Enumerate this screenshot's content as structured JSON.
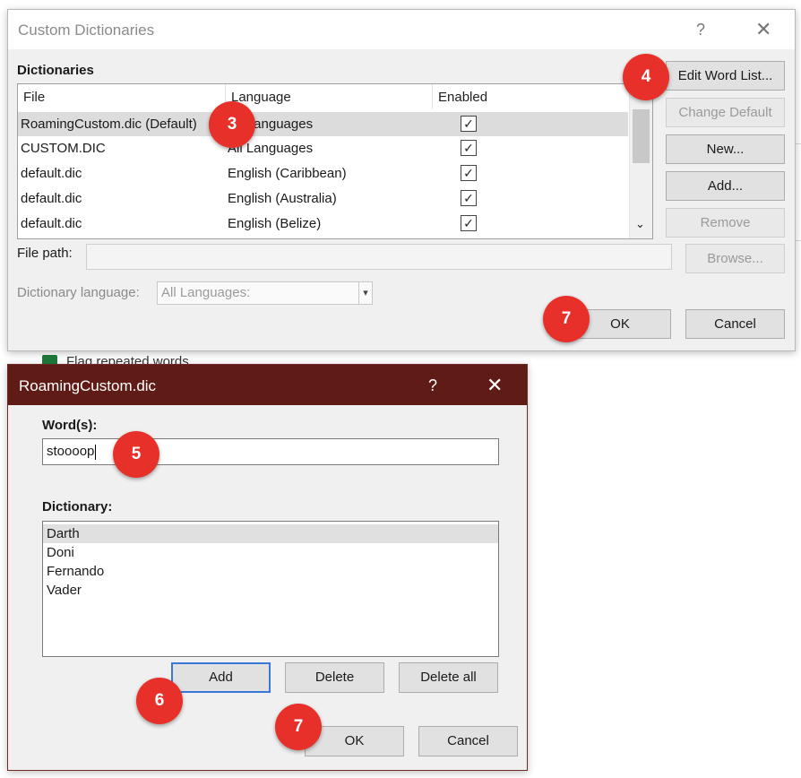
{
  "dialog1": {
    "title": "Custom Dictionaries",
    "help_icon": "?",
    "close_icon": "✕",
    "section_label": "Dictionaries",
    "columns": [
      "File",
      "Language",
      "Enabled"
    ],
    "rows": [
      {
        "file": "RoamingCustom.dic (Default)",
        "language": "All Languages",
        "enabled": true
      },
      {
        "file": "CUSTOM.DIC",
        "language": "All Languages",
        "enabled": true
      },
      {
        "file": "default.dic",
        "language": "English (Caribbean)",
        "enabled": true
      },
      {
        "file": "default.dic",
        "language": "English (Australia)",
        "enabled": true
      },
      {
        "file": "default.dic",
        "language": "English (Belize)",
        "enabled": true
      }
    ],
    "buttons": {
      "edit_word_list": "Edit Word List...",
      "change_default": "Change Default",
      "new": "New...",
      "add": "Add...",
      "remove": "Remove",
      "browse": "Browse...",
      "ok": "OK",
      "cancel": "Cancel"
    },
    "file_path_label": "File path:",
    "file_path_value": "",
    "dictionary_language_label": "Dictionary language:",
    "dictionary_language_value": "All Languages:"
  },
  "background": {
    "partial_option": "Flag repeated words"
  },
  "dialog2": {
    "title": "RoamingCustom.dic",
    "help_icon": "?",
    "close_icon": "✕",
    "words_label": "Word(s):",
    "words_value": "stoooop",
    "dictionary_label": "Dictionary:",
    "dictionary_items": [
      "Darth",
      "Doni",
      "Fernando",
      "Vader"
    ],
    "buttons": {
      "add": "Add",
      "delete": "Delete",
      "delete_all": "Delete all",
      "ok": "OK",
      "cancel": "Cancel"
    }
  },
  "callouts": {
    "c3": "3",
    "c4": "4",
    "c5": "5",
    "c6": "6",
    "c7a": "7",
    "c7b": "7"
  },
  "colors": {
    "callout": "#e8302a",
    "dialog2_titlebar": "#5f1c16",
    "focus_border": "#3a78d8"
  }
}
